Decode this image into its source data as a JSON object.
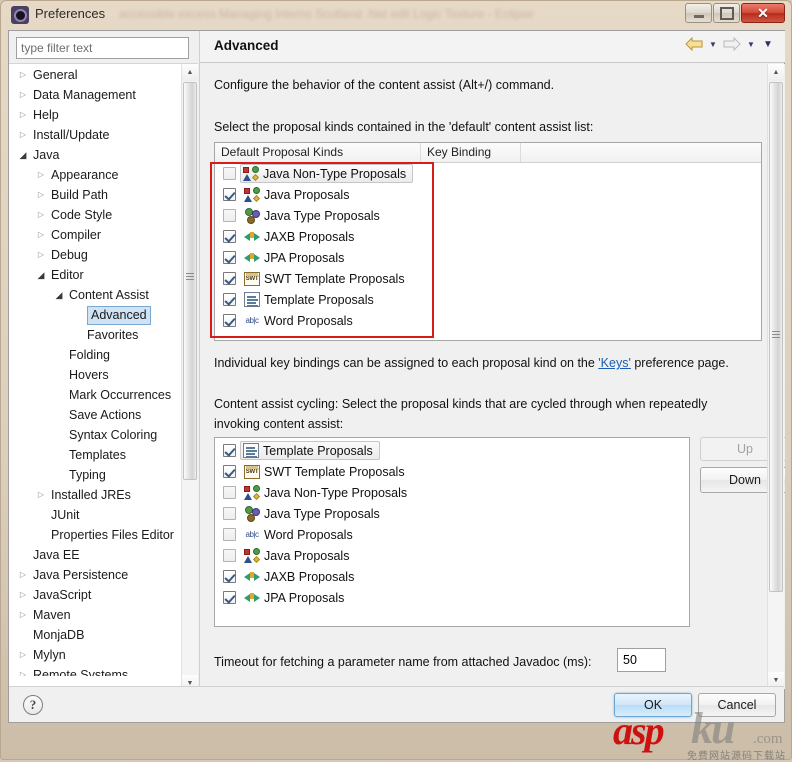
{
  "window": {
    "title": "Preferences",
    "title_ghost": "accessible excess Managing Interns Scotland .Net edit Logic Texture - Eclipse",
    "icon": "preferences-gear-icon",
    "buttons": {
      "minimize": "minimize-icon",
      "maximize": "maximize-icon",
      "close": "✕"
    }
  },
  "sidebar": {
    "filter": {
      "placeholder": "type filter text",
      "value": ""
    },
    "items": [
      {
        "label": "General",
        "indent": 0,
        "arrow": "collapsed",
        "selected": false
      },
      {
        "label": "Data Management",
        "indent": 0,
        "arrow": "collapsed",
        "selected": false
      },
      {
        "label": "Help",
        "indent": 0,
        "arrow": "collapsed",
        "selected": false
      },
      {
        "label": "Install/Update",
        "indent": 0,
        "arrow": "collapsed",
        "selected": false
      },
      {
        "label": "Java",
        "indent": 0,
        "arrow": "expanded",
        "selected": false
      },
      {
        "label": "Appearance",
        "indent": 1,
        "arrow": "collapsed",
        "selected": false
      },
      {
        "label": "Build Path",
        "indent": 1,
        "arrow": "collapsed",
        "selected": false
      },
      {
        "label": "Code Style",
        "indent": 1,
        "arrow": "collapsed",
        "selected": false
      },
      {
        "label": "Compiler",
        "indent": 1,
        "arrow": "collapsed",
        "selected": false
      },
      {
        "label": "Debug",
        "indent": 1,
        "arrow": "collapsed",
        "selected": false
      },
      {
        "label": "Editor",
        "indent": 1,
        "arrow": "expanded",
        "selected": false
      },
      {
        "label": "Content Assist",
        "indent": 2,
        "arrow": "expanded",
        "selected": false
      },
      {
        "label": "Advanced",
        "indent": 3,
        "arrow": "none",
        "selected": true
      },
      {
        "label": "Favorites",
        "indent": 3,
        "arrow": "none",
        "selected": false
      },
      {
        "label": "Folding",
        "indent": 2,
        "arrow": "none",
        "selected": false
      },
      {
        "label": "Hovers",
        "indent": 2,
        "arrow": "none",
        "selected": false
      },
      {
        "label": "Mark Occurrences",
        "indent": 2,
        "arrow": "none",
        "selected": false
      },
      {
        "label": "Save Actions",
        "indent": 2,
        "arrow": "none",
        "selected": false
      },
      {
        "label": "Syntax Coloring",
        "indent": 2,
        "arrow": "none",
        "selected": false
      },
      {
        "label": "Templates",
        "indent": 2,
        "arrow": "none",
        "selected": false
      },
      {
        "label": "Typing",
        "indent": 2,
        "arrow": "none",
        "selected": false
      },
      {
        "label": "Installed JREs",
        "indent": 1,
        "arrow": "collapsed",
        "selected": false
      },
      {
        "label": "JUnit",
        "indent": 1,
        "arrow": "none",
        "selected": false
      },
      {
        "label": "Properties Files Editor",
        "indent": 1,
        "arrow": "none",
        "selected": false
      },
      {
        "label": "Java EE",
        "indent": 0,
        "arrow": "none",
        "selected": false
      },
      {
        "label": "Java Persistence",
        "indent": 0,
        "arrow": "collapsed",
        "selected": false
      },
      {
        "label": "JavaScript",
        "indent": 0,
        "arrow": "collapsed",
        "selected": false
      },
      {
        "label": "Maven",
        "indent": 0,
        "arrow": "collapsed",
        "selected": false
      },
      {
        "label": "MonjaDB",
        "indent": 0,
        "arrow": "none",
        "selected": false
      },
      {
        "label": "Mylyn",
        "indent": 0,
        "arrow": "collapsed",
        "selected": false
      },
      {
        "label": "Remote Systems",
        "indent": 0,
        "arrow": "collapsed",
        "selected": false
      }
    ]
  },
  "page": {
    "title": "Advanced",
    "nav": {
      "back": "back-arrow-icon",
      "back_menu": "chevron-down-icon",
      "forward": "forward-arrow-icon",
      "forward_menu": "chevron-down-icon",
      "view_menu": "chevron-down-icon"
    },
    "description": "Configure the behavior of the content assist (Alt+/) command.",
    "default_section_label": "Select the proposal kinds contained in the 'default' content assist list:",
    "default_table": {
      "columns": [
        "Default Proposal Kinds",
        "Key Binding",
        ""
      ],
      "rows": [
        {
          "label": "Java Non-Type Proposals",
          "checked": false,
          "icon": "java-proposal-icon",
          "key_binding": "",
          "selected": true
        },
        {
          "label": "Java Proposals",
          "checked": true,
          "icon": "java-proposal-icon",
          "key_binding": "",
          "selected": false
        },
        {
          "label": "Java Type Proposals",
          "checked": false,
          "icon": "java-type-icon",
          "key_binding": "",
          "selected": false
        },
        {
          "label": "JAXB Proposals",
          "checked": true,
          "icon": "jaxb-icon",
          "key_binding": "",
          "selected": false
        },
        {
          "label": "JPA Proposals",
          "checked": true,
          "icon": "jaxb-icon",
          "key_binding": "",
          "selected": false
        },
        {
          "label": "SWT Template Proposals",
          "checked": true,
          "icon": "swt-template-icon",
          "key_binding": "",
          "selected": false
        },
        {
          "label": "Template Proposals",
          "checked": true,
          "icon": "template-icon",
          "key_binding": "",
          "selected": false
        },
        {
          "label": "Word Proposals",
          "checked": true,
          "icon": "word-proposal-icon",
          "key_binding": "",
          "selected": false
        }
      ]
    },
    "keys_note_before": "Individual key bindings can be assigned to each proposal kind on the ",
    "keys_link": "'Keys'",
    "keys_note_after": " preference page.",
    "cycling_label_line1": "Content assist cycling: Select the proposal kinds that are cycled through when repeatedly",
    "cycling_label_line2": "invoking content assist:",
    "cycling_table": {
      "rows": [
        {
          "label": "Template Proposals",
          "checked": true,
          "icon": "template-icon",
          "selected": true
        },
        {
          "label": "SWT Template Proposals",
          "checked": true,
          "icon": "swt-template-icon",
          "selected": false
        },
        {
          "label": "Java Non-Type Proposals",
          "checked": false,
          "icon": "java-proposal-icon",
          "selected": false
        },
        {
          "label": "Java Type Proposals",
          "checked": false,
          "icon": "java-type-icon",
          "selected": false
        },
        {
          "label": "Word Proposals",
          "checked": false,
          "icon": "word-proposal-icon",
          "selected": false
        },
        {
          "label": "Java Proposals",
          "checked": false,
          "icon": "java-proposal-icon",
          "selected": false
        },
        {
          "label": "JAXB Proposals",
          "checked": true,
          "icon": "jaxb-icon",
          "selected": false
        },
        {
          "label": "JPA Proposals",
          "checked": true,
          "icon": "jaxb-icon",
          "selected": false
        }
      ]
    },
    "up_button": "Up",
    "down_button": "Down",
    "timeout_label": "Timeout for fetching a parameter name from attached Javadoc (ms):",
    "timeout_value": "50"
  },
  "footer": {
    "help": "?",
    "ok": "OK",
    "cancel": "Cancel"
  },
  "watermark": {
    "asp": "asp",
    "ku": "ku",
    "com": ".com",
    "chinese": "免费网站源码下载站"
  },
  "colors": {
    "accent_red": "#d81b1b",
    "link": "#1a5fb4",
    "selection": "#cfe3f5",
    "titlebar": "#e6d9c6"
  }
}
